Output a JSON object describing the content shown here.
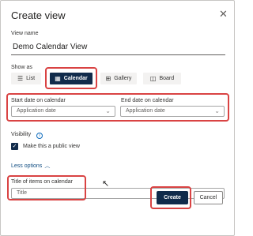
{
  "dialog": {
    "title": "Create view",
    "close_icon": "close-icon"
  },
  "view_name": {
    "label": "View name",
    "value": "Demo Calendar View"
  },
  "show_as": {
    "label": "Show as",
    "options": [
      {
        "label": "List",
        "icon": "list-icon",
        "selected": false
      },
      {
        "label": "Calendar",
        "icon": "calendar-icon",
        "selected": true
      },
      {
        "label": "Gallery",
        "icon": "gallery-icon",
        "selected": false
      },
      {
        "label": "Board",
        "icon": "board-icon",
        "selected": false
      }
    ]
  },
  "start_date": {
    "label": "Start date on calendar",
    "value": "Application date"
  },
  "end_date": {
    "label": "End date on calendar",
    "value": "Application date"
  },
  "visibility": {
    "label": "Visibility",
    "info_icon": "info-icon",
    "checkbox_label": "Make this a public view",
    "checked": true
  },
  "less_options": {
    "label": "Less options",
    "icon": "chevron-up-icon"
  },
  "title_items": {
    "label": "Title of items on calendar",
    "value": "Title"
  },
  "buttons": {
    "create": "Create",
    "cancel": "Cancel"
  },
  "colors": {
    "accent": "#112b4b",
    "highlight": "#d94343",
    "link": "#0f4c81"
  }
}
